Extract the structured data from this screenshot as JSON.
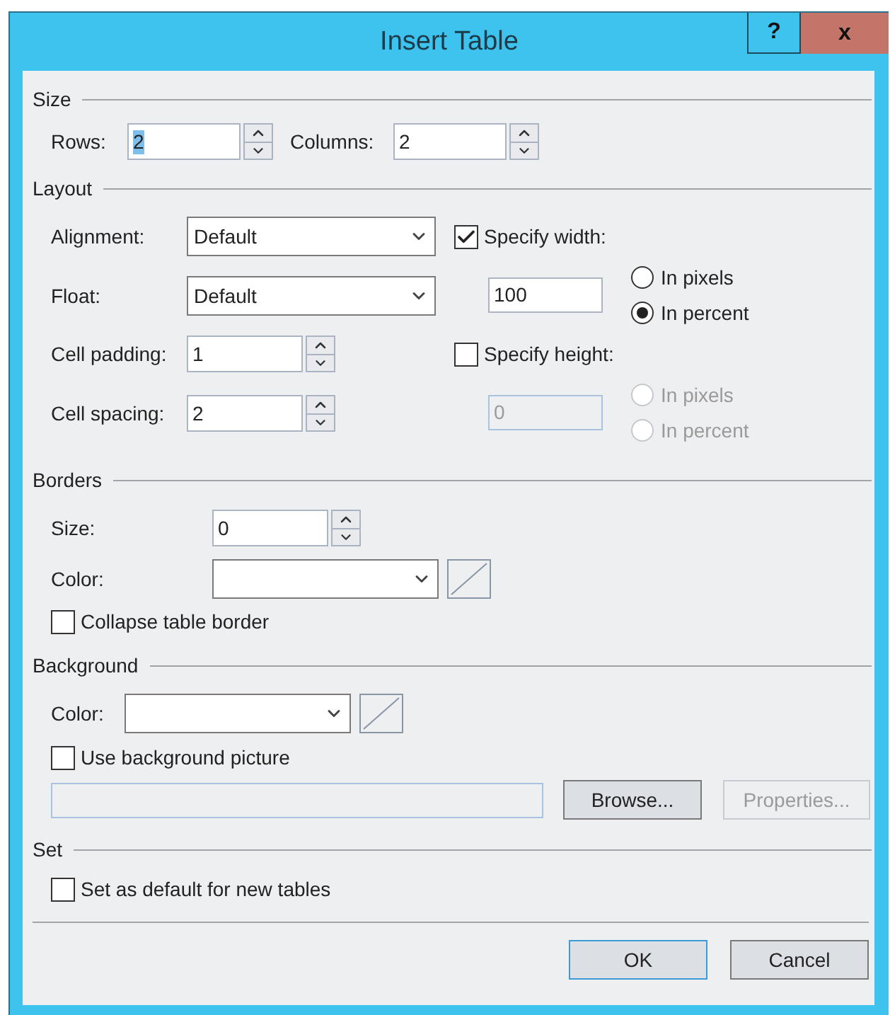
{
  "window": {
    "title": "Insert Table",
    "buttons": [
      {
        "kind": "help",
        "label": "?"
      },
      {
        "kind": "close",
        "label": "x"
      }
    ]
  },
  "size": {
    "legend": "Size",
    "rows": {
      "label": "Rows:",
      "value": "2",
      "highlighted": true
    },
    "columns": {
      "label": "Columns:",
      "value": "2",
      "highlighted": false
    }
  },
  "layout": {
    "legend": "Layout",
    "alignment": {
      "label": "Alignment:",
      "value": "Default"
    },
    "float": {
      "label": "Float:",
      "value": "Default"
    },
    "cell_padding": {
      "label": "Cell padding:",
      "value": "1"
    },
    "cell_spacing": {
      "label": "Cell spacing:",
      "value": "2"
    },
    "specify_width": {
      "label": "Specify width:",
      "checked": true,
      "value": "100",
      "disabled": false,
      "units": [
        {
          "label": "In pixels",
          "selected": false
        },
        {
          "label": "In percent",
          "selected": true
        }
      ]
    },
    "specify_height": {
      "label": "Specify height:",
      "checked": false,
      "value": "0",
      "disabled": true,
      "units": [
        {
          "label": "In pixels",
          "selected": false
        },
        {
          "label": "In percent",
          "selected": false
        }
      ]
    }
  },
  "borders": {
    "legend": "Borders",
    "size": {
      "label": "Size:",
      "value": "0"
    },
    "color": {
      "label": "Color:"
    },
    "collapse": {
      "label": "Collapse table border",
      "checked": false
    }
  },
  "background": {
    "legend": "Background",
    "color": {
      "label": "Color:"
    },
    "use_picture": {
      "label": "Use background picture",
      "checked": false
    },
    "picture_path": {
      "disabled": true
    },
    "buttons": [
      {
        "label": "Browse...",
        "disabled": false
      },
      {
        "label": "Properties...",
        "disabled": true
      }
    ]
  },
  "set": {
    "legend": "Set",
    "default": {
      "label": "Set as default for new tables",
      "checked": false
    }
  },
  "footer": [
    {
      "label": "OK",
      "default": true
    },
    {
      "label": "Cancel",
      "default": false
    }
  ]
}
